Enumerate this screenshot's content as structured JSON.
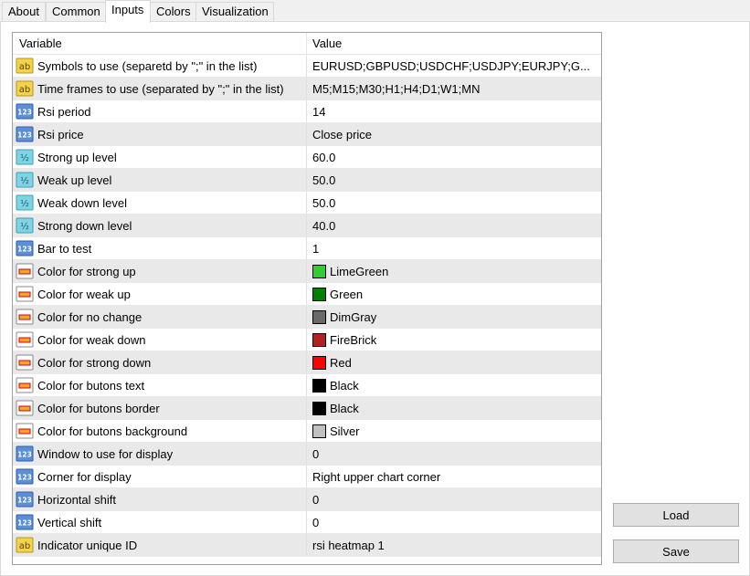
{
  "tabs": [
    {
      "label": "About",
      "active": false
    },
    {
      "label": "Common",
      "active": false
    },
    {
      "label": "Inputs",
      "active": true
    },
    {
      "label": "Colors",
      "active": false
    },
    {
      "label": "Visualization",
      "active": false
    }
  ],
  "table": {
    "headers": {
      "variable": "Variable",
      "value": "Value"
    },
    "rows": [
      {
        "type": "string",
        "variable": "Symbols to use (separetd by \";\" in the list)",
        "value": "EURUSD;GBPUSD;USDCHF;USDJPY;EURJPY;G..."
      },
      {
        "type": "string",
        "variable": "Time frames to use (separated by \";\" in the list)",
        "value": "M5;M15;M30;H1;H4;D1;W1;MN"
      },
      {
        "type": "integer",
        "variable": "Rsi period",
        "value": "14"
      },
      {
        "type": "integer",
        "variable": "Rsi price",
        "value": "Close price"
      },
      {
        "type": "double",
        "variable": "Strong up level",
        "value": "60.0"
      },
      {
        "type": "double",
        "variable": "Weak up level",
        "value": "50.0"
      },
      {
        "type": "double",
        "variable": "Weak down level",
        "value": "50.0"
      },
      {
        "type": "double",
        "variable": "Strong down level",
        "value": "40.0"
      },
      {
        "type": "integer",
        "variable": "Bar to test",
        "value": "1"
      },
      {
        "type": "color",
        "variable": "Color for strong up",
        "value": "LimeGreen",
        "color": "#32cd32"
      },
      {
        "type": "color",
        "variable": "Color for weak up",
        "value": "Green",
        "color": "#008000"
      },
      {
        "type": "color",
        "variable": "Color for no change",
        "value": "DimGray",
        "color": "#696969"
      },
      {
        "type": "color",
        "variable": "Color for weak down",
        "value": "FireBrick",
        "color": "#b22222"
      },
      {
        "type": "color",
        "variable": "Color for strong down",
        "value": "Red",
        "color": "#ff0000"
      },
      {
        "type": "color",
        "variable": "Color for butons text",
        "value": "Black",
        "color": "#000000"
      },
      {
        "type": "color",
        "variable": "Color for butons border",
        "value": "Black",
        "color": "#000000"
      },
      {
        "type": "color",
        "variable": "Color for butons background",
        "value": "Silver",
        "color": "#c0c0c0"
      },
      {
        "type": "integer",
        "variable": "Window to use for display",
        "value": "0"
      },
      {
        "type": "integer",
        "variable": "Corner for display",
        "value": "Right upper chart corner"
      },
      {
        "type": "integer",
        "variable": "Horizontal shift",
        "value": "0"
      },
      {
        "type": "integer",
        "variable": "Vertical shift",
        "value": "0"
      },
      {
        "type": "string",
        "variable": "Indicator unique ID",
        "value": "rsi heatmap 1"
      }
    ]
  },
  "buttons": {
    "load": "Load",
    "save": "Save"
  },
  "icons": {
    "string": "ab-string-icon",
    "integer": "123-integer-icon",
    "double": "half-double-icon",
    "color": "color-palette-icon"
  }
}
